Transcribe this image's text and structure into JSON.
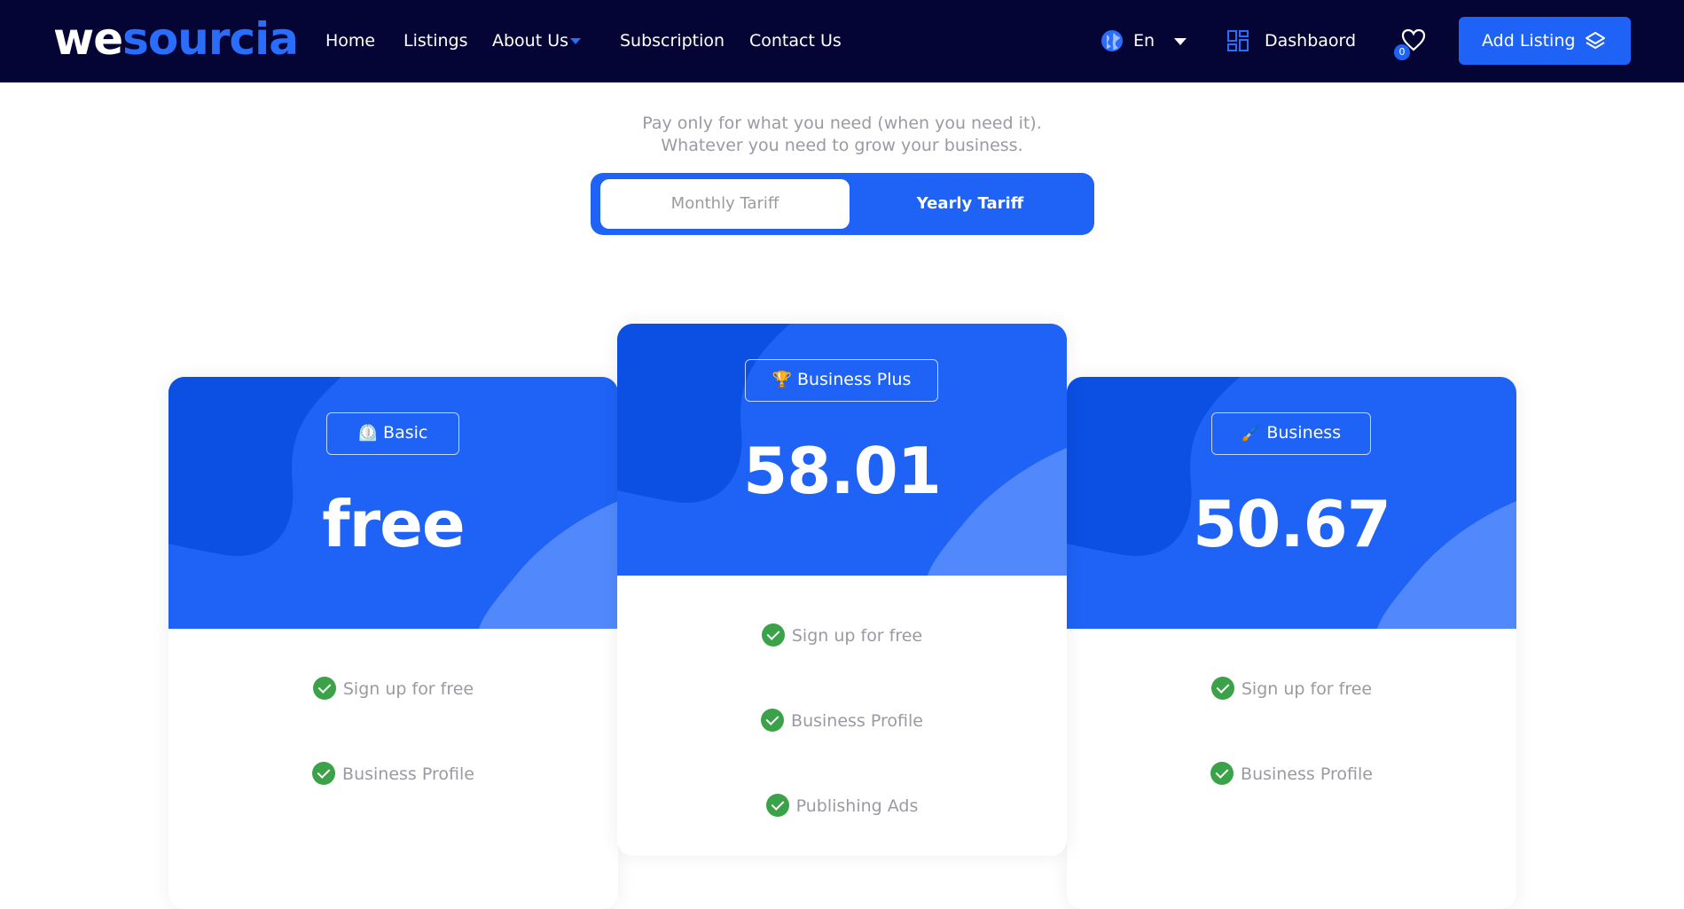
{
  "nav": {
    "logo_we": "we",
    "logo_rest": "sourcia",
    "links": [
      "Home",
      "Listings",
      "About Us",
      "Subscription",
      "Contact Us"
    ],
    "language": "En",
    "dashboard": "Dashbaord",
    "wishlist_count": "0",
    "add_listing": "Add Listing"
  },
  "intro": {
    "line1": "Pay only for what you need (when you need it).",
    "line2": "Whatever you need to grow your business."
  },
  "toggle": {
    "monthly": "Monthly Tariff",
    "yearly": "Yearly Tariff",
    "selected": "Monthly Tariff"
  },
  "plans": [
    {
      "name": "Basic",
      "emoji": "⏲️",
      "price": "free",
      "features": [
        "Sign up for free",
        "Business Profile"
      ]
    },
    {
      "name": "Business Plus",
      "emoji": "🏆",
      "price": "58.01",
      "features": [
        "Sign up for free",
        "Business Profile",
        "Publishing Ads"
      ]
    },
    {
      "name": "Business",
      "emoji": "🖌️",
      "price": "50.67",
      "features": [
        "Sign up for free",
        "Business Profile"
      ]
    }
  ],
  "colors": {
    "nav_bg": "#040534",
    "primary": "#1e63f5",
    "check_green": "#3ca24a",
    "muted_text": "#9a9aa2"
  }
}
